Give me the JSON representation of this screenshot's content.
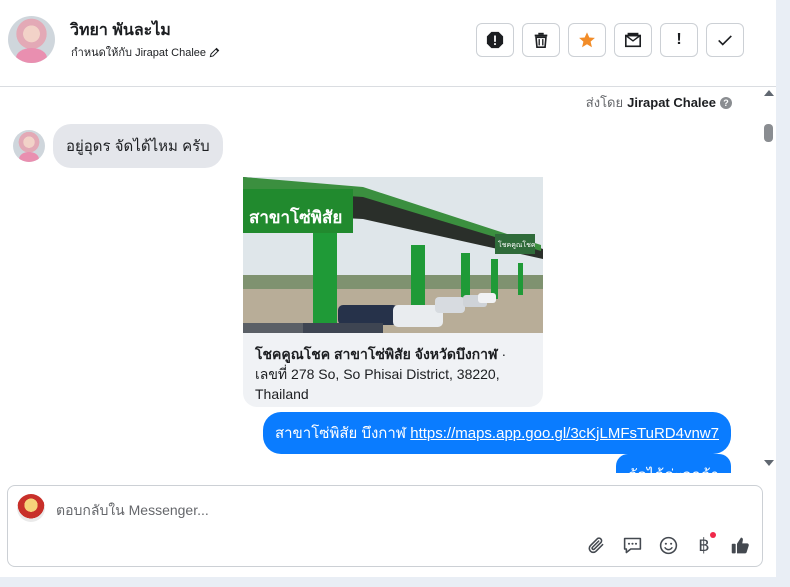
{
  "header": {
    "contact_name": "วิทยา พันละไม",
    "assigned_text": "กำหนดให้กับ Jirapat Chalee",
    "actions": [
      {
        "name": "spam-button",
        "icon": "alert-octagon-icon"
      },
      {
        "name": "delete-button",
        "icon": "trash-icon"
      },
      {
        "name": "star-button",
        "icon": "star-icon"
      },
      {
        "name": "mark-unread-button",
        "icon": "envelope-x-icon"
      },
      {
        "name": "follow-up-button",
        "icon": "exclamation-icon"
      },
      {
        "name": "done-button",
        "icon": "check-icon"
      }
    ],
    "follow_up_label": "!"
  },
  "conversation": {
    "sent_by_prefix": "ส่งโดย",
    "sent_by_name": "Jirapat Chalee",
    "help_label": "?",
    "incoming_message": "อยู่อุดร จัดได้ไหม ครับ",
    "link_card": {
      "title": "โชคคูณโชค สาขาโซ่พิสัย จังหวัดบึงกาฬ",
      "address": "· เลขที่ 278 So, So Phisai District, 38220, Thailand",
      "sign_text": "สาขาโซ่พิสัย",
      "sign_small": "โชคคูณโชค"
    },
    "outgoing_prefix": "สาขาโซ่พิสัย บึงกาฬ",
    "outgoing_link": "https://maps.app.goo.gl/3cKjLMFsTuRD4vnw7",
    "outgoing_partial": "จัดได้ค่ะลูกค้า"
  },
  "composer": {
    "placeholder": "ตอบกลับใน Messenger...",
    "currency_symbol": "฿"
  },
  "colors": {
    "accent": "#0a7cff",
    "star": "#f28c28",
    "notification_dot": "#f0284a"
  }
}
